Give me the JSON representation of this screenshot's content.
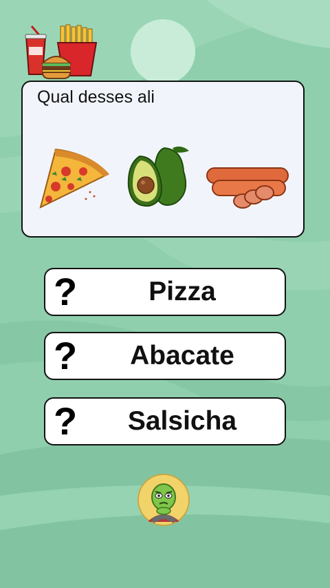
{
  "question": {
    "text": "Qual desses ali",
    "images": [
      "pizza-slice",
      "avocado",
      "sausage"
    ]
  },
  "answers": [
    {
      "marker": "?",
      "label": "Pizza"
    },
    {
      "marker": "?",
      "label": "Abacate"
    },
    {
      "marker": "?",
      "label": "Salsicha"
    }
  ],
  "icons": {
    "logo": "fast-food-logo",
    "avatar": "green-alien-avatar"
  },
  "colors": {
    "background": "#8fcfae",
    "card": "#f1f5fb",
    "answer": "#ffffff",
    "border": "#111111"
  }
}
